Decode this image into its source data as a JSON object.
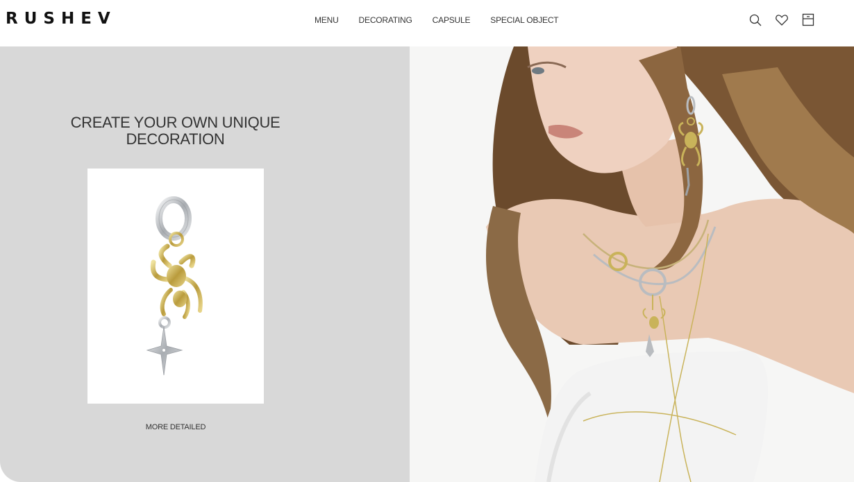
{
  "header": {
    "logo": "RUSHEV",
    "nav": [
      "MENU",
      "DECORATING",
      "CAPSULE",
      "SPECIAL OBJECT"
    ],
    "icons": [
      "search-icon",
      "heart-icon",
      "cart-icon"
    ]
  },
  "promo": {
    "headline": "CREATE YOUR OWN UNIQUE DECORATION",
    "more_link": "MORE DETAILED",
    "product_image": "earring-spider-star-pendant"
  },
  "hero": {
    "image": "model-wearing-jewelry"
  },
  "colors": {
    "panel_bg": "#d8d8d8",
    "gold": "#c9b35a",
    "silver": "#c4c7cb"
  }
}
